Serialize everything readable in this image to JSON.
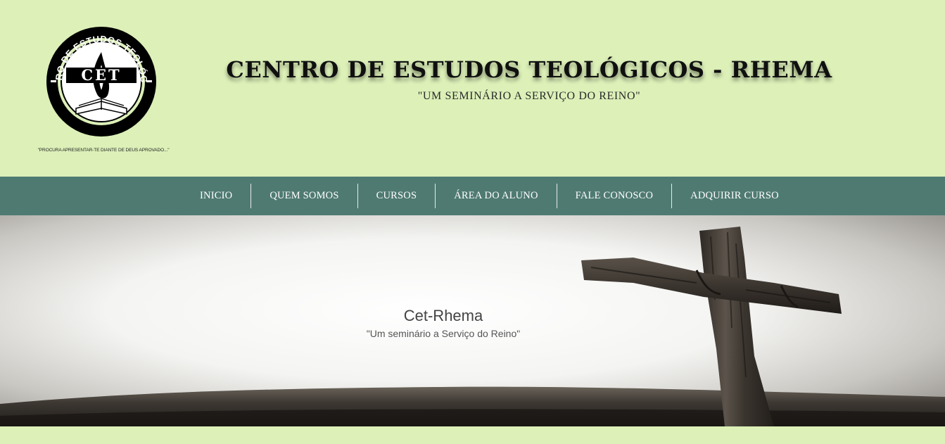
{
  "header": {
    "logo": {
      "ring_text_top": "CENTRO DE ESTUDOS TEOLÓGICOS",
      "ring_text_bottom": "Rhema",
      "center_text": "CET"
    },
    "logo_tagline": "\"PROCURA APRESENTAR-TE DIANTE DE DEUS APROVADO...\"",
    "title": "CENTRO DE ESTUDOS TEOLÓGICOS - RHEMA",
    "subtitle": "\"UM SEMINÁRIO A SERVIÇO DO REINO\""
  },
  "nav": {
    "items": [
      {
        "label": "INICIO"
      },
      {
        "label": "QUEM SOMOS"
      },
      {
        "label": "CURSOS"
      },
      {
        "label": "ÁREA DO ALUNO"
      },
      {
        "label": "FALE CONOSCO"
      },
      {
        "label": "ADQUIRIR CURSO"
      }
    ]
  },
  "hero": {
    "title": "Cet-Rhema",
    "subtitle": "\"Um seminário a Serviço do Reino\""
  },
  "colors": {
    "page_background": "#dcf0b8",
    "nav_background": "#4f7a72",
    "nav_text": "#ffffff",
    "title_text": "#101010"
  }
}
